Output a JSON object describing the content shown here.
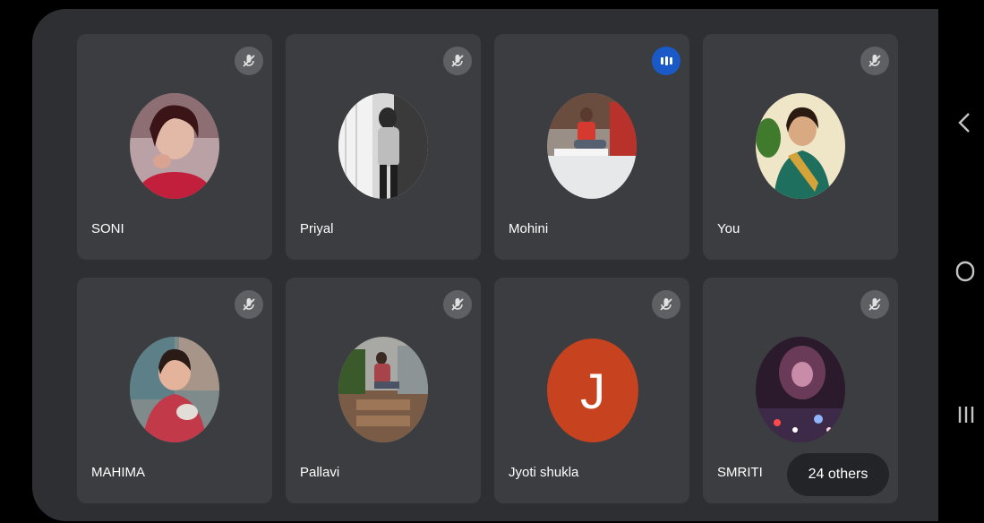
{
  "participants": [
    {
      "name": "SONI",
      "status": "muted",
      "avatar": "photo"
    },
    {
      "name": "Priyal",
      "status": "muted",
      "avatar": "photo"
    },
    {
      "name": "Mohini",
      "status": "speaking",
      "avatar": "photo"
    },
    {
      "name": "You",
      "status": "muted",
      "avatar": "photo"
    },
    {
      "name": "MAHIMA",
      "status": "muted",
      "avatar": "photo"
    },
    {
      "name": "Pallavi",
      "status": "muted",
      "avatar": "photo"
    },
    {
      "name": "Jyoti shukla",
      "status": "muted",
      "avatar": "letter",
      "initial": "J"
    },
    {
      "name": "SMRITI",
      "status": "muted",
      "avatar": "photo"
    }
  ],
  "others_label": "24 others",
  "colors": {
    "background": "#000000",
    "meet_area": "#2e2f32",
    "tile": "#3c3d41",
    "speaking_badge": "#1a5ac8",
    "letter_avatar": "#c7421f"
  },
  "nav": {
    "back_icon": "chevron-left-icon",
    "home_icon": "home-circle-icon",
    "recents_icon": "recents-icon"
  }
}
